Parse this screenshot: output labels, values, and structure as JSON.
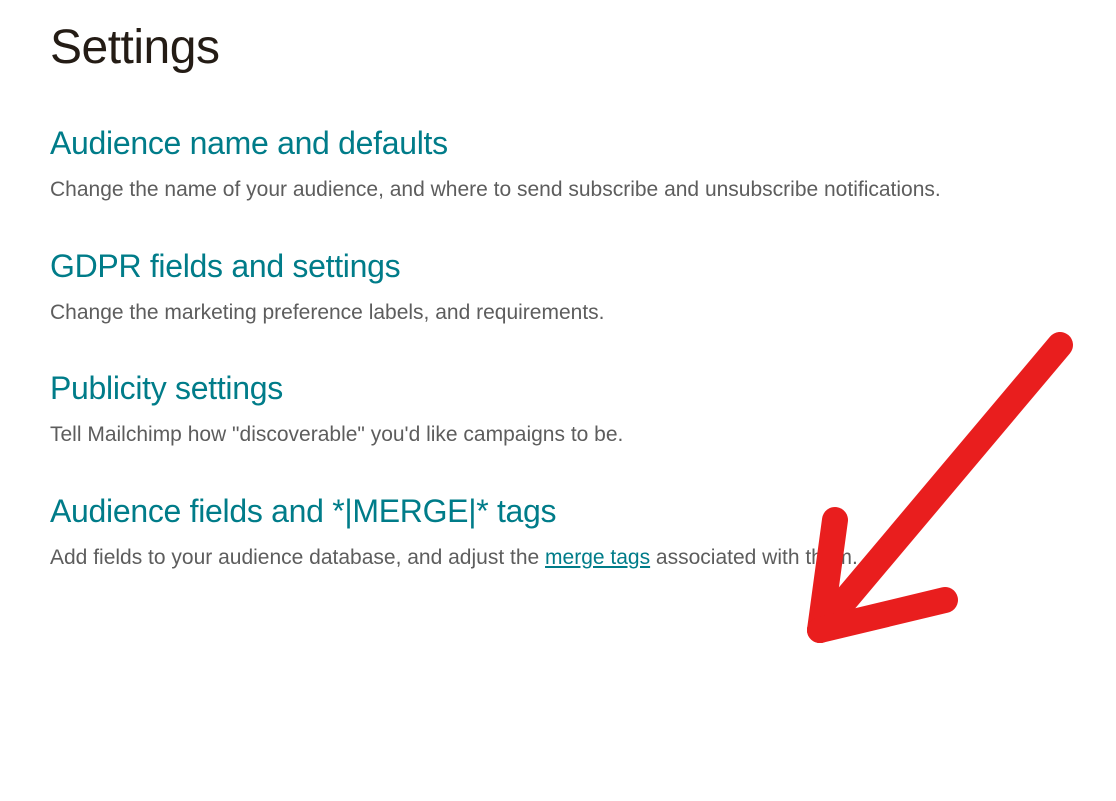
{
  "page": {
    "title": "Settings"
  },
  "sections": [
    {
      "heading": "Audience name and defaults",
      "description": "Change the name of your audience, and where to send subscribe and unsubscribe notifications."
    },
    {
      "heading": "GDPR fields and settings",
      "description": "Change the marketing preference labels, and requirements."
    },
    {
      "heading": "Publicity settings",
      "description": "Tell Mailchimp how \"discoverable\" you'd like campaigns to be."
    },
    {
      "heading": "Audience fields and *|MERGE|* tags",
      "description_pre": "Add fields to your audience database, and adjust the ",
      "description_link": "merge tags",
      "description_post": " associated with them."
    }
  ],
  "annotation": {
    "type": "hand-drawn-arrow",
    "color": "#e91e1e",
    "points_to": "Audience fields and *|MERGE|* tags"
  }
}
